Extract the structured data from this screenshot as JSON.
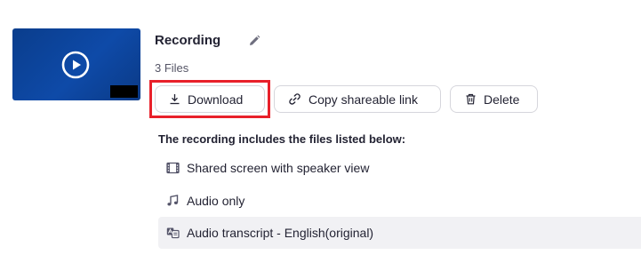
{
  "recording": {
    "title": "Recording",
    "file_count": "3 Files"
  },
  "actions": {
    "download_label": "Download",
    "copy_link_label": "Copy shareable link",
    "delete_label": "Delete"
  },
  "files": {
    "heading": "The recording includes the files listed below:",
    "items": [
      {
        "label": "Shared screen with speaker view",
        "icon": "video-file-icon"
      },
      {
        "label": "Audio only",
        "icon": "music-note-icon"
      },
      {
        "label": "Audio transcript - English(original)",
        "icon": "transcript-icon"
      }
    ]
  },
  "colors": {
    "thumbnail": "#0e4aa8",
    "highlight": "#e8202a",
    "selected_row": "#f1f1f4"
  }
}
